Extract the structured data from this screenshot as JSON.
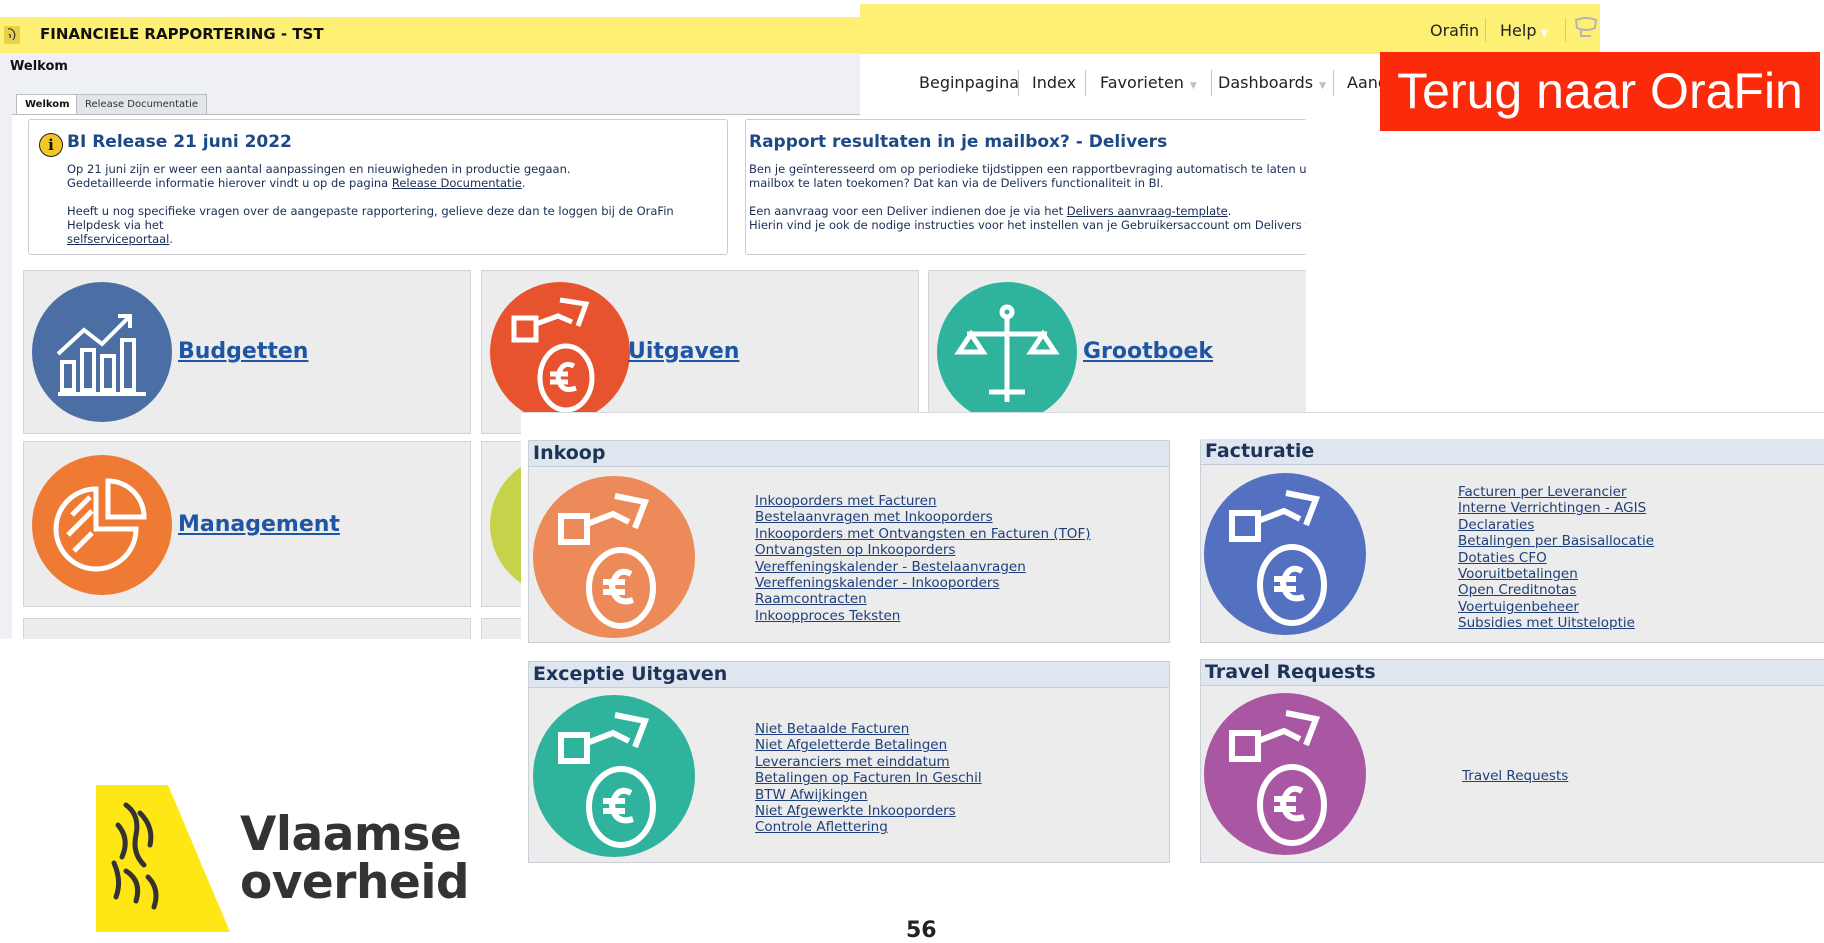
{
  "app": {
    "title": "FINANCIELE RAPPORTERING - TST",
    "page_heading": "Welkom"
  },
  "tabs": [
    {
      "label": "Welkom"
    },
    {
      "label": "Release Documentatie"
    }
  ],
  "notice_left": {
    "title": "BI Release 21 juni 2022",
    "line1": "Op 21 juni zijn er weer een aantal aanpassingen en nieuwigheden in productie gegaan.",
    "line2_prefix": "Gedetailleerde informatie hierover vindt u op de pagina ",
    "line2_link": "Release Documentatie",
    "line3": "Heeft u nog specifieke vragen over de aangepaste rapportering, gelieve deze dan te loggen bij de OraFin Helpdesk via het",
    "line4_link": "selfserviceportaal"
  },
  "notice_right": {
    "title": "Rapport resultaten in je mailbox? - Delivers",
    "line1": "Ben je geïnteresseerd om op periodieke tijdstippen een rapportbevraging automatisch te laten uitvoeren",
    "line2": "mailbox te laten toekomen? Dat kan via de Delivers functionaliteit in BI.",
    "line3_prefix": "Een aanvraag voor een Deliver indienen doe je via het ",
    "line3_link": "Delivers aanvraag-template",
    "line4": "Hierin vind je ook de nodige instructies voor het instellen van je Gebruikersaccount om Delivers te kunn"
  },
  "tiles": [
    {
      "label": "Budgetten",
      "color": "#4b6fa5"
    },
    {
      "label": "Uitgaven",
      "color": "#e8532f"
    },
    {
      "label": "Grootboek",
      "color": "#2fb39c"
    },
    {
      "label": "Management",
      "color": "#ee7a34"
    }
  ],
  "top_links": {
    "orafin": "Orafin",
    "help": "Help"
  },
  "nav": [
    "Beginpagina",
    "Index",
    "Favorieten",
    "Dashboards",
    "Aang"
  ],
  "back_button": "Terug naar OraFin",
  "panels": [
    {
      "title": "Inkoop",
      "color": "#ec8a5a",
      "links": [
        "Inkooporders met Facturen",
        "Bestelaanvragen met Inkooporders",
        "Inkooporders met Ontvangsten en Facturen (TOF)",
        "Ontvangsten op Inkooporders",
        "Vereffeningskalender - Bestelaanvragen",
        "Vereffeningskalender - Inkooporders",
        "Raamcontracten",
        "Inkoopproces Teksten"
      ]
    },
    {
      "title": "Facturatie",
      "color": "#5470c0",
      "links": [
        "Facturen per Leverancier",
        "Interne Verrichtingen - AGIS",
        "Declaraties",
        "Betalingen per Basisallocatie",
        "Dotaties CFO",
        "Vooruitbetalingen",
        "Open Creditnotas",
        "Voertuigenbeheer",
        "Subsidies met Uitsteloptie"
      ]
    },
    {
      "title": "Exceptie Uitgaven",
      "color": "#2fb39c",
      "links": [
        "Niet Betaalde Facturen",
        "Niet Afgeletterde Betalingen",
        "Leveranciers met einddatum",
        "Betalingen op Facturen In Geschil",
        "BTW Afwijkingen",
        "Niet Afgewerkte Inkooporders",
        "Controle Aflettering"
      ]
    },
    {
      "title": "Travel Requests",
      "color": "#a957a3",
      "links": [
        "Travel Requests"
      ]
    }
  ],
  "logo": {
    "line1": "Vlaamse",
    "line2": "overheid",
    "color": "#ffe615"
  },
  "slide_number": "56"
}
